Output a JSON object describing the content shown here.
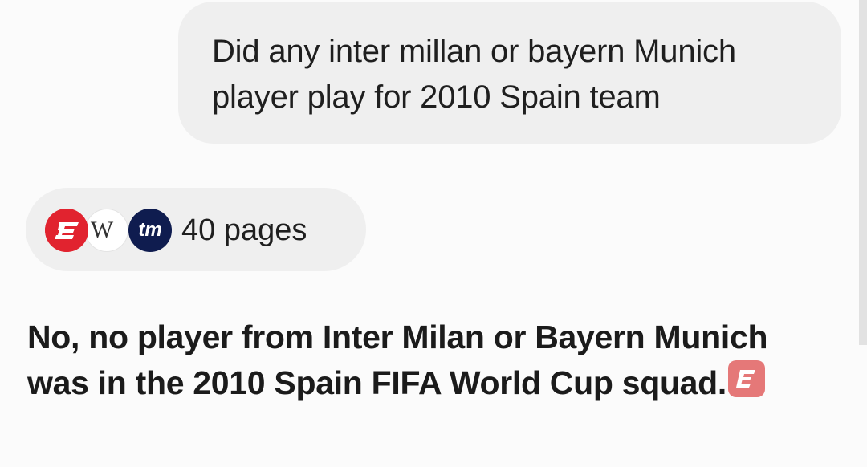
{
  "user_message": {
    "text": "Did any inter millan or bayern Munich player play for 2010 Spain team"
  },
  "sources": {
    "label": "40 pages",
    "icons": [
      "espn-icon",
      "wikipedia-icon",
      "transfermarkt-icon"
    ],
    "wiki_glyph": "W",
    "tm_glyph": "tm"
  },
  "answer": {
    "text": "No, no player from Inter Milan or Bayern Munich was in the 2010 Spain FIFA World Cup squad.",
    "citation_icon": "espn-icon"
  },
  "colors": {
    "espn_red": "#e1232f",
    "tm_navy": "#0f1c4f",
    "citation_pink": "#e57878",
    "bubble_gray": "#efefef"
  }
}
